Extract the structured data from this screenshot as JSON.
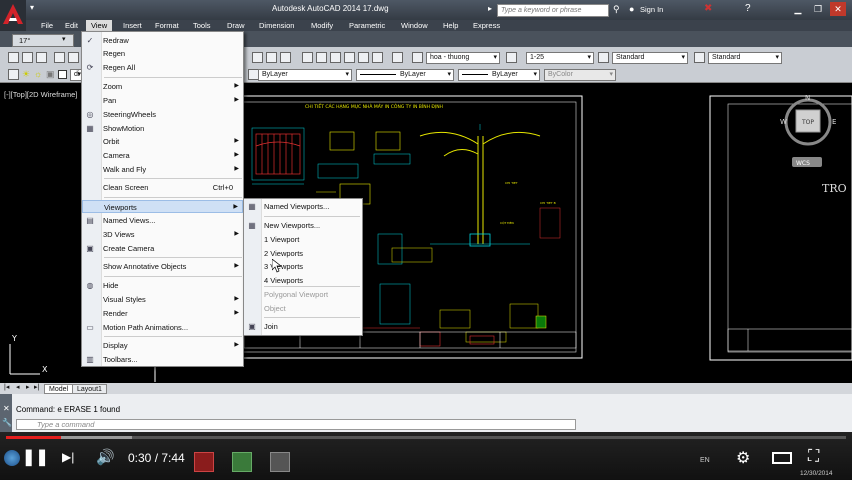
{
  "window": {
    "title": "Autodesk AutoCAD 2014    17.dwg",
    "search_placeholder": "Type a keyword or phrase",
    "signin": "Sign In",
    "doc_tab": "17°"
  },
  "menubar": [
    "File",
    "Edit",
    "View",
    "Insert",
    "Format",
    "Tools",
    "Draw",
    "Dimension",
    "Modify",
    "Parametric",
    "Window",
    "Help",
    "Express"
  ],
  "toolbar": {
    "layer_combo": "ByLayer",
    "linetype_combo": "ByLayer",
    "lineweight_combo": "ByLayer",
    "color_combo": "ByColor",
    "text_style": "hoa - thuong",
    "dim_scale": "1-25",
    "table_style": "Standard",
    "multileader_style": "Standard",
    "layer_name": "di"
  },
  "viewport_label": "[-][Top][2D Wireframe]",
  "drawing": {
    "sheet_title": "CHI TIẾT CÁC HẠNG MỤC NHÀ MÁY IN CÔNG TY IN BÌNH ĐỊNH",
    "compass_n": "N",
    "compass_s": "S",
    "compass_e": "E",
    "compass_w": "W",
    "compass_top": "TOP",
    "wcs": "WCS",
    "right_text": "TRO"
  },
  "view_menu": {
    "items": [
      {
        "label": "Redraw",
        "icon": "redraw-icon"
      },
      {
        "label": "Regen",
        "icon": ""
      },
      {
        "label": "Regen All",
        "icon": "regen-all-icon"
      },
      {
        "label": "Zoom",
        "submenu": true
      },
      {
        "label": "Pan",
        "submenu": true
      },
      {
        "label": "SteeringWheels",
        "icon": "steering-wheel-icon"
      },
      {
        "label": "ShowMotion",
        "icon": "showmotion-icon"
      },
      {
        "label": "Orbit",
        "submenu": true
      },
      {
        "label": "Camera",
        "submenu": true
      },
      {
        "label": "Walk and Fly",
        "submenu": true
      },
      {
        "label": "Clean Screen",
        "shortcut": "Ctrl+0"
      },
      {
        "label": "Viewports",
        "submenu": true,
        "highlighted": true
      },
      {
        "label": "Named Views...",
        "icon": "named-views-icon"
      },
      {
        "label": "3D Views",
        "submenu": true
      },
      {
        "label": "Create Camera",
        "icon": "camera-icon"
      },
      {
        "label": "Show Annotative Objects",
        "submenu": true
      },
      {
        "label": "Hide",
        "icon": "hide-icon"
      },
      {
        "label": "Visual Styles",
        "submenu": true
      },
      {
        "label": "Render",
        "submenu": true
      },
      {
        "label": "Motion Path Animations...",
        "icon": "motion-path-icon"
      },
      {
        "label": "Display",
        "submenu": true
      },
      {
        "label": "Toolbars...",
        "icon": "toolbars-icon"
      }
    ]
  },
  "viewports_menu": {
    "items": [
      {
        "label": "Named Viewports...",
        "icon": "named-viewports-icon"
      },
      {
        "label": "New Viewports...",
        "icon": "new-viewports-icon"
      },
      {
        "label": "1 Viewport"
      },
      {
        "label": "2 Viewports"
      },
      {
        "label": "3 Viewports"
      },
      {
        "label": "4 Viewports"
      },
      {
        "label": "Polygonal Viewport",
        "disabled": true
      },
      {
        "label": "Object",
        "disabled": true
      },
      {
        "label": "Join",
        "icon": "join-icon"
      }
    ]
  },
  "layout_tabs": [
    "Model",
    "Layout1"
  ],
  "command": {
    "history": "Command: e ERASE 1 found",
    "placeholder": "Type a command"
  },
  "player": {
    "time": "0:30 / 7:44",
    "progress": 0.065,
    "buffered": 0.15
  },
  "taskbar": {
    "lang": "EN",
    "date": "12/30/2014"
  },
  "colors": {
    "menu_highlight": "#cfe0f5",
    "progress_red": "#e41e1e",
    "cad_yellow": "#e6e600",
    "cad_cyan": "#00d8e0"
  }
}
